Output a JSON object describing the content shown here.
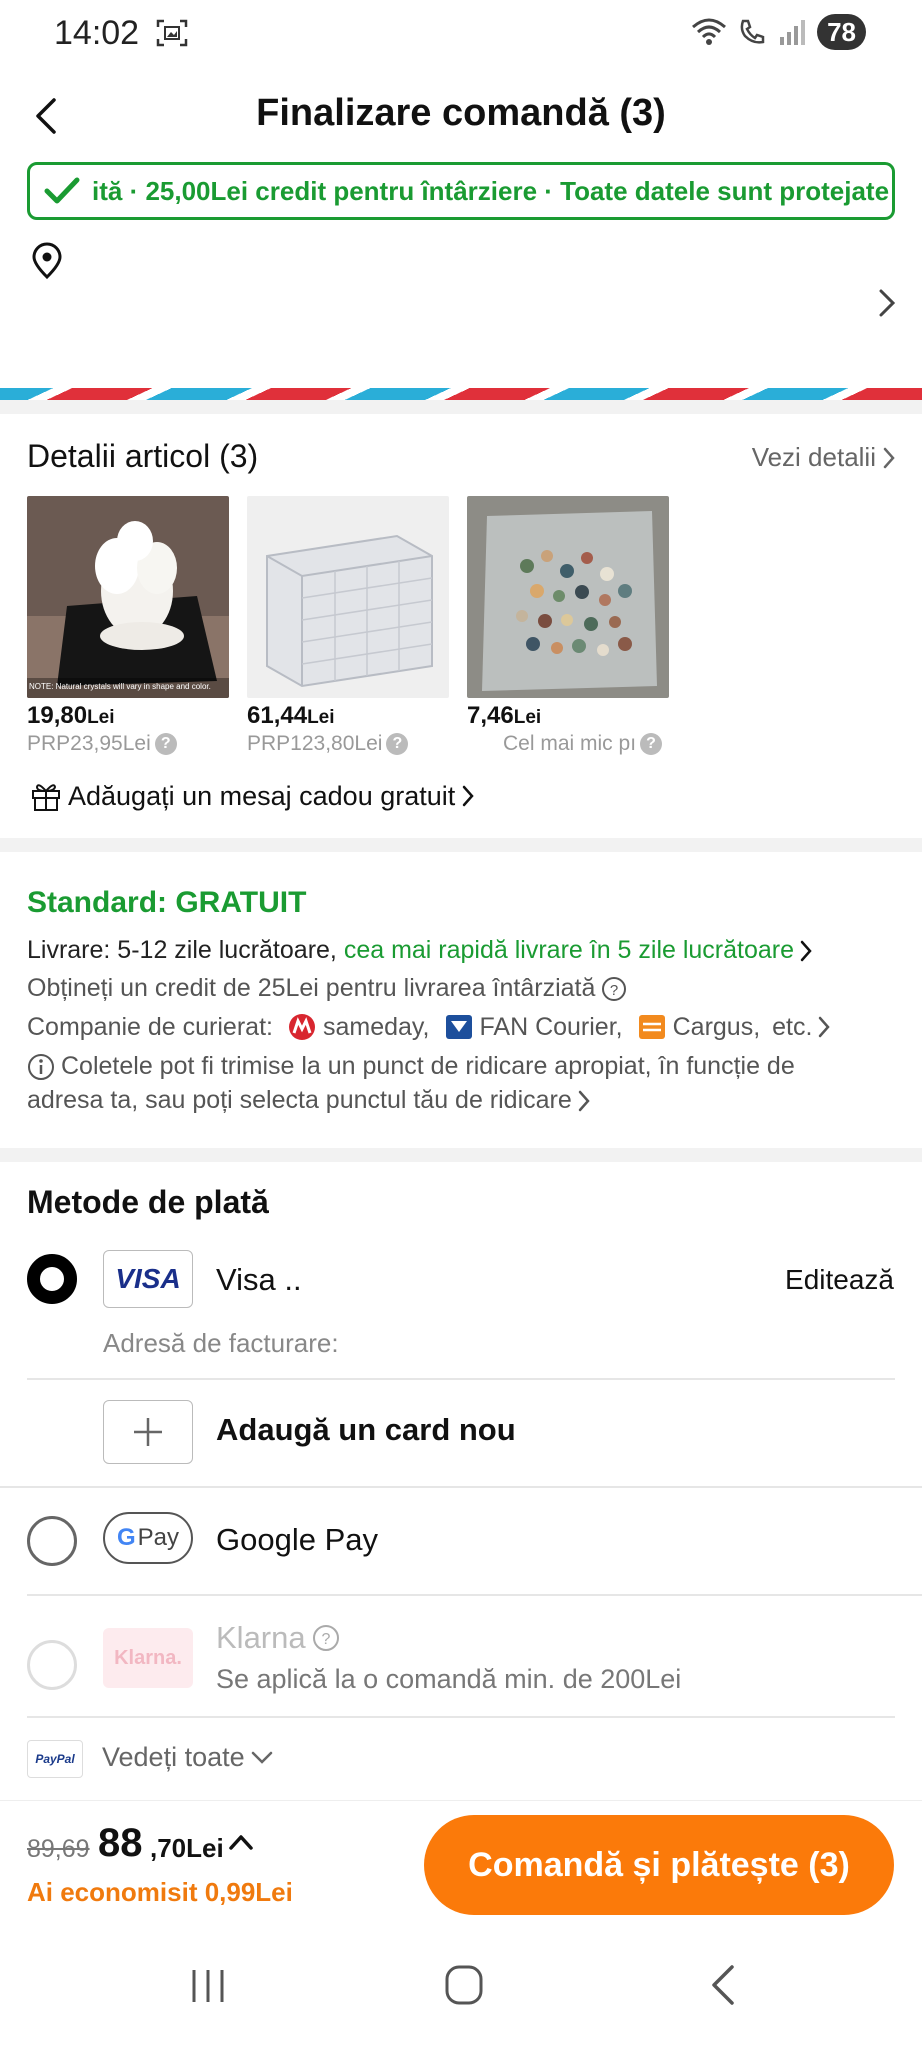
{
  "status_bar": {
    "time": "14:02",
    "battery": "78"
  },
  "header": {
    "title": "Finalizare comandă (3)"
  },
  "banner": {
    "text": "ită · 25,00Lei credit pentru întârziere · Toate datele sunt protejate"
  },
  "items_section": {
    "title": "Detalii articol (3)",
    "see_details": "Vezi detalii",
    "products": [
      {
        "price_main": "19,80",
        "currency": "Lei",
        "rrp": "PRP23,95Lei",
        "image": "white-crystal-cluster",
        "image_note": "NOTE: Natural crystals will vary in shape and color."
      },
      {
        "price_main": "61,44",
        "currency": "Lei",
        "rrp": "PRP123,80Lei",
        "image": "clear-drawer-organizer"
      },
      {
        "price_main": "7,46",
        "currency": "Lei",
        "rrp": "Cel mai mic pı",
        "image": "tumbled-stone-chips"
      }
    ],
    "gift_message": "Adăugați un mesaj cadou gratuit"
  },
  "shipping": {
    "title": "Standard: GRATUIT",
    "delivery_prefix": "Livrare: 5-12 zile lucrătoare, ",
    "delivery_fast": "cea mai rapidă livrare în 5 zile lucrătoare",
    "credit": "Obțineți un credit de 25Lei pentru livrarea întârziată",
    "courier_prefix": "Companie de curierat:",
    "couriers": [
      "sameday,",
      "FAN Courier,",
      "Cargus,",
      "etc."
    ],
    "pickup_line1": "Coletele pot fi trimise la un punct de ridicare apropiat, în funcție de",
    "pickup_line2": "adresa ta, sau poți selecta punctul tău de ridicare",
    "colors": {
      "green": "#1a9b32"
    }
  },
  "payment": {
    "title": "Metode de plată",
    "visa": {
      "logo": "VISA",
      "label": "Visa ..",
      "edit": "Editează",
      "billing": "Adresă de facturare:"
    },
    "add_card": "Adaugă un card nou",
    "google_pay": {
      "logo_g": "G",
      "logo_pay": "Pay",
      "label": "Google Pay"
    },
    "klarna": {
      "logo": "Klarna.",
      "label": "Klarna",
      "note": "Se aplică la o comandă min. de 200Lei"
    },
    "paypal": {
      "logo": "PayPal",
      "see_all": "Vedeți toate"
    }
  },
  "bottom_bar": {
    "old_total": "89,69",
    "total_main": "88",
    "total_rest": ",70Lei",
    "saved": "Ai economisit 0,99Lei",
    "order_button": "Comandă și plătește (3)",
    "colors": {
      "accent": "#fb7a0a"
    }
  }
}
